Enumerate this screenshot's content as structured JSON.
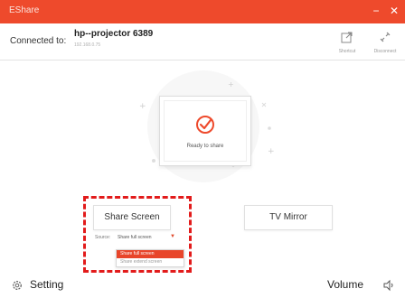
{
  "app": {
    "title": "EShare"
  },
  "window_controls": {
    "minimize": "−",
    "close": "✕"
  },
  "connection": {
    "label": "Connected to:",
    "device_name": "hp--projector 6389",
    "device_ip": "192.168.0.75"
  },
  "toolbar": {
    "shortcut_label": "Shortcut",
    "disconnect_label": "Disconnect"
  },
  "status": {
    "ready_text": "Ready to share"
  },
  "actions": {
    "share_screen": "Share Screen",
    "tv_mirror": "TV Mirror"
  },
  "source": {
    "label": "Source:",
    "selected": "Share full screen",
    "options": [
      "Share full screen",
      "Share extend screen"
    ]
  },
  "footer": {
    "setting_label": "Setting",
    "volume_label": "Volume"
  },
  "colors": {
    "accent": "#ee4a2c",
    "highlight_border": "#e21b1b",
    "dropdown_active": "#e8452a"
  }
}
